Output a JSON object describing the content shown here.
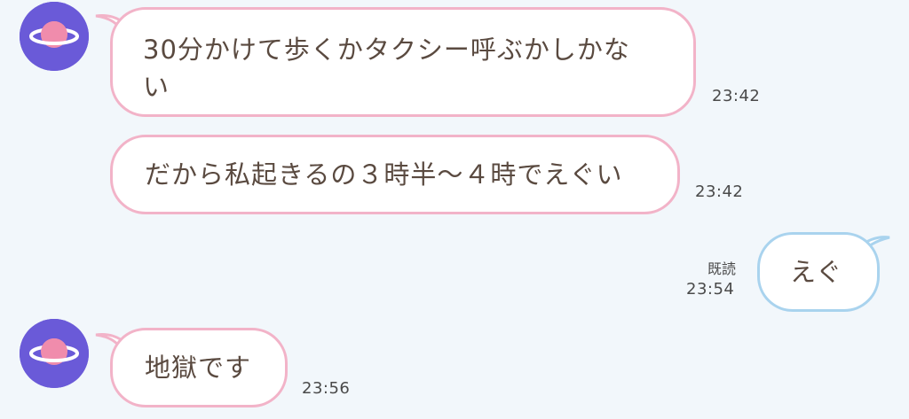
{
  "messages": [
    {
      "direction": "incoming",
      "avatar_icon": "planet-icon",
      "lines": [
        "30分かけて歩くかタクシー呼ぶかしかな",
        "い"
      ],
      "time": "23:42"
    },
    {
      "direction": "incoming",
      "lines": [
        "だから私起きるの３時半〜４時でえぐい"
      ],
      "time": "23:42"
    },
    {
      "direction": "outgoing",
      "lines": [
        "えぐ"
      ],
      "read_label": "既読",
      "time": "23:54"
    },
    {
      "direction": "incoming",
      "avatar_icon": "planet-icon",
      "lines": [
        "地獄です"
      ],
      "time": "23:56"
    }
  ],
  "colors": {
    "background": "#f2f7fb",
    "incoming_border": "#f2b3c8",
    "outgoing_border": "#a9d3ee",
    "avatar": "#6a5ad8",
    "text": "#5a4a40"
  }
}
